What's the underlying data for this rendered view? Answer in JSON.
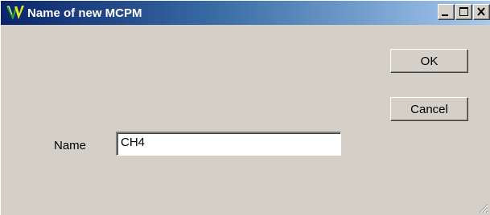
{
  "window": {
    "title": "Name of new MCPM",
    "app_icon": "mcpm-app-icon",
    "caption_buttons": [
      "minimize-icon",
      "maximize-icon",
      "close-icon"
    ]
  },
  "dialog": {
    "ok_label": "OK",
    "cancel_label": "Cancel",
    "name_label": "Name",
    "name_value": "CH4"
  },
  "colors": {
    "titlebar_start": "#0a246a",
    "titlebar_end": "#a6caf0",
    "face": "#d4d0c8"
  }
}
